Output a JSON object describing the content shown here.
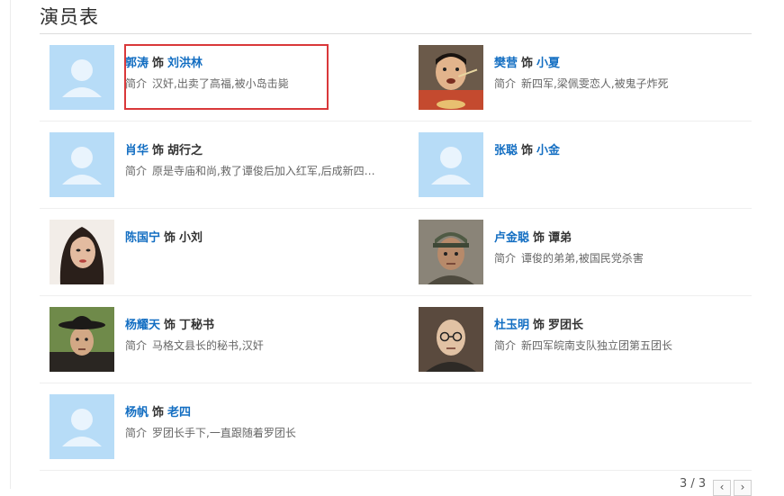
{
  "section_title": "演员表",
  "shi_word": "饰",
  "desc_label": "简介",
  "cast": [
    {
      "actor": "郭涛",
      "role": "刘洪林",
      "desc": "汉奸,出卖了高福,被小岛击毙",
      "photo": "placeholder-avatar"
    },
    {
      "actor": "樊营",
      "role": "小夏",
      "desc": "新四军,梁佩雯恋人,被鬼子炸死",
      "photo": "man-eating-noodles"
    },
    {
      "actor": "肖华",
      "role": "胡行之",
      "desc": "原是寺庙和尚,救了谭俊后加入红军,后成新四…",
      "photo": "placeholder-avatar"
    },
    {
      "actor": "张聪",
      "role": "小金",
      "desc": "",
      "photo": "placeholder-avatar"
    },
    {
      "actor": "陈国宁",
      "role": "小刘",
      "desc": "",
      "photo": "woman-portrait"
    },
    {
      "actor": "卢金聪",
      "role": "谭弟",
      "desc": "谭俊的弟弟,被国民党杀害",
      "photo": "man-in-cap"
    },
    {
      "actor": "杨耀天",
      "role": "丁秘书",
      "desc": "马格文县长的秘书,汉奸",
      "photo": "man-in-hat"
    },
    {
      "actor": "杜玉明",
      "role": "罗团长",
      "desc": "新四军皖南支队独立团第五团长",
      "photo": "bald-man-glasses"
    },
    {
      "actor": "杨帆",
      "role": "老四",
      "desc": "罗团长手下,一直跟随着罗团长",
      "photo": "placeholder-avatar"
    }
  ],
  "pager": {
    "label": "3 / 3",
    "prev_icon": "chevron-left-icon",
    "next_icon": "chevron-right-icon"
  },
  "colors": {
    "actor_link": "#136ec2",
    "highlight_box": "#d9383a"
  }
}
